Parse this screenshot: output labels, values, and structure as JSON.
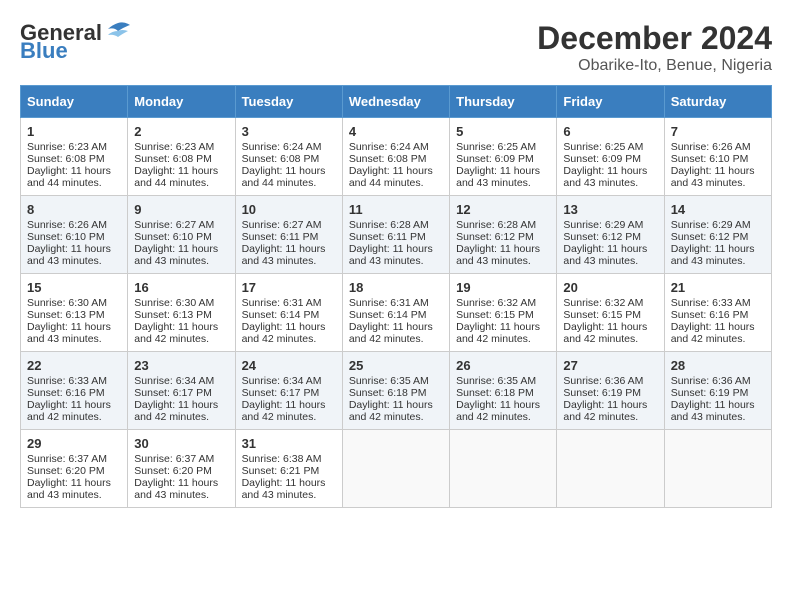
{
  "header": {
    "logo_line1": "General",
    "logo_line2": "Blue",
    "title": "December 2024",
    "subtitle": "Obarike-Ito, Benue, Nigeria"
  },
  "days_of_week": [
    "Sunday",
    "Monday",
    "Tuesday",
    "Wednesday",
    "Thursday",
    "Friday",
    "Saturday"
  ],
  "weeks": [
    [
      {
        "day": 1,
        "sunrise": "6:23 AM",
        "sunset": "6:08 PM",
        "daylight": "11 hours and 44 minutes."
      },
      {
        "day": 2,
        "sunrise": "6:23 AM",
        "sunset": "6:08 PM",
        "daylight": "11 hours and 44 minutes."
      },
      {
        "day": 3,
        "sunrise": "6:24 AM",
        "sunset": "6:08 PM",
        "daylight": "11 hours and 44 minutes."
      },
      {
        "day": 4,
        "sunrise": "6:24 AM",
        "sunset": "6:08 PM",
        "daylight": "11 hours and 44 minutes."
      },
      {
        "day": 5,
        "sunrise": "6:25 AM",
        "sunset": "6:09 PM",
        "daylight": "11 hours and 43 minutes."
      },
      {
        "day": 6,
        "sunrise": "6:25 AM",
        "sunset": "6:09 PM",
        "daylight": "11 hours and 43 minutes."
      },
      {
        "day": 7,
        "sunrise": "6:26 AM",
        "sunset": "6:10 PM",
        "daylight": "11 hours and 43 minutes."
      }
    ],
    [
      {
        "day": 8,
        "sunrise": "6:26 AM",
        "sunset": "6:10 PM",
        "daylight": "11 hours and 43 minutes."
      },
      {
        "day": 9,
        "sunrise": "6:27 AM",
        "sunset": "6:10 PM",
        "daylight": "11 hours and 43 minutes."
      },
      {
        "day": 10,
        "sunrise": "6:27 AM",
        "sunset": "6:11 PM",
        "daylight": "11 hours and 43 minutes."
      },
      {
        "day": 11,
        "sunrise": "6:28 AM",
        "sunset": "6:11 PM",
        "daylight": "11 hours and 43 minutes."
      },
      {
        "day": 12,
        "sunrise": "6:28 AM",
        "sunset": "6:12 PM",
        "daylight": "11 hours and 43 minutes."
      },
      {
        "day": 13,
        "sunrise": "6:29 AM",
        "sunset": "6:12 PM",
        "daylight": "11 hours and 43 minutes."
      },
      {
        "day": 14,
        "sunrise": "6:29 AM",
        "sunset": "6:12 PM",
        "daylight": "11 hours and 43 minutes."
      }
    ],
    [
      {
        "day": 15,
        "sunrise": "6:30 AM",
        "sunset": "6:13 PM",
        "daylight": "11 hours and 43 minutes."
      },
      {
        "day": 16,
        "sunrise": "6:30 AM",
        "sunset": "6:13 PM",
        "daylight": "11 hours and 42 minutes."
      },
      {
        "day": 17,
        "sunrise": "6:31 AM",
        "sunset": "6:14 PM",
        "daylight": "11 hours and 42 minutes."
      },
      {
        "day": 18,
        "sunrise": "6:31 AM",
        "sunset": "6:14 PM",
        "daylight": "11 hours and 42 minutes."
      },
      {
        "day": 19,
        "sunrise": "6:32 AM",
        "sunset": "6:15 PM",
        "daylight": "11 hours and 42 minutes."
      },
      {
        "day": 20,
        "sunrise": "6:32 AM",
        "sunset": "6:15 PM",
        "daylight": "11 hours and 42 minutes."
      },
      {
        "day": 21,
        "sunrise": "6:33 AM",
        "sunset": "6:16 PM",
        "daylight": "11 hours and 42 minutes."
      }
    ],
    [
      {
        "day": 22,
        "sunrise": "6:33 AM",
        "sunset": "6:16 PM",
        "daylight": "11 hours and 42 minutes."
      },
      {
        "day": 23,
        "sunrise": "6:34 AM",
        "sunset": "6:17 PM",
        "daylight": "11 hours and 42 minutes."
      },
      {
        "day": 24,
        "sunrise": "6:34 AM",
        "sunset": "6:17 PM",
        "daylight": "11 hours and 42 minutes."
      },
      {
        "day": 25,
        "sunrise": "6:35 AM",
        "sunset": "6:18 PM",
        "daylight": "11 hours and 42 minutes."
      },
      {
        "day": 26,
        "sunrise": "6:35 AM",
        "sunset": "6:18 PM",
        "daylight": "11 hours and 42 minutes."
      },
      {
        "day": 27,
        "sunrise": "6:36 AM",
        "sunset": "6:19 PM",
        "daylight": "11 hours and 42 minutes."
      },
      {
        "day": 28,
        "sunrise": "6:36 AM",
        "sunset": "6:19 PM",
        "daylight": "11 hours and 43 minutes."
      }
    ],
    [
      {
        "day": 29,
        "sunrise": "6:37 AM",
        "sunset": "6:20 PM",
        "daylight": "11 hours and 43 minutes."
      },
      {
        "day": 30,
        "sunrise": "6:37 AM",
        "sunset": "6:20 PM",
        "daylight": "11 hours and 43 minutes."
      },
      {
        "day": 31,
        "sunrise": "6:38 AM",
        "sunset": "6:21 PM",
        "daylight": "11 hours and 43 minutes."
      },
      null,
      null,
      null,
      null
    ]
  ]
}
